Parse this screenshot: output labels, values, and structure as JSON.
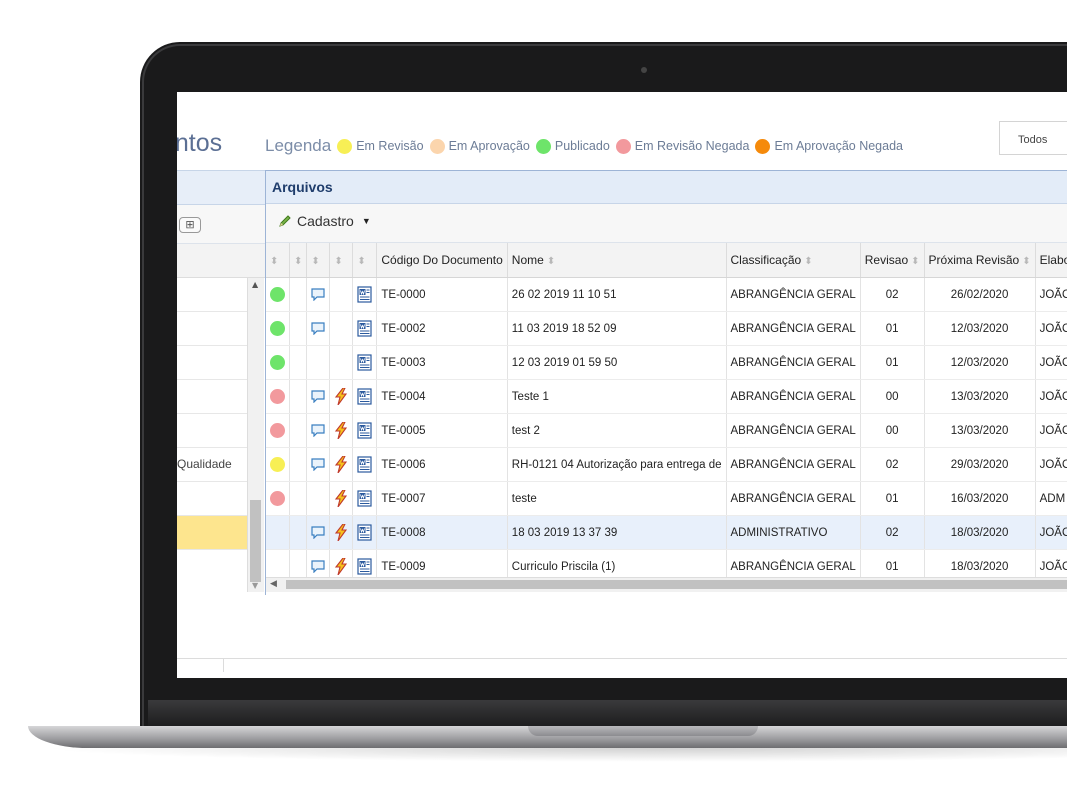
{
  "header": {
    "title_fragment": "entos",
    "legend_label": "Legenda",
    "legend": [
      {
        "label": "Em Revisão",
        "color": "#f7ef55"
      },
      {
        "label": "Em Aprovação",
        "color": "#fbd5ad"
      },
      {
        "label": "Publicado",
        "color": "#6ee46a"
      },
      {
        "label": "Em Revisão Negada",
        "color": "#f2999d"
      },
      {
        "label": "Em Aprovação Negada",
        "color": "#f58a0b"
      }
    ],
    "filter_value": "Todos"
  },
  "left_panel": {
    "expand_label": "⊞",
    "rows": [
      "",
      "",
      "",
      "",
      "",
      "Qualidade",
      "",
      ""
    ],
    "selected_row": 7
  },
  "files": {
    "title": "Arquivos",
    "cadastro_label": "Cadastro",
    "columns": [
      "",
      "",
      "",
      "",
      "",
      "Código Do Documento",
      "Nome",
      "Classificação",
      "Revisao",
      "Próxima Revisão",
      "Elaborador"
    ],
    "rows": [
      {
        "status": "green",
        "comment": true,
        "bolt": false,
        "code": "TE-0000",
        "name": "26 02 2019 11 10 51",
        "class": "ABRANGÊNCIA GERAL",
        "rev": "02",
        "next": "26/02/2020",
        "author": "JOÃO LOPES"
      },
      {
        "status": "green",
        "comment": true,
        "bolt": false,
        "code": "TE-0002",
        "name": "11 03 2019 18 52 09",
        "class": "ABRANGÊNCIA GERAL",
        "rev": "01",
        "next": "12/03/2020",
        "author": "JOÃO LOPES"
      },
      {
        "status": "green",
        "comment": false,
        "bolt": false,
        "code": "TE-0003",
        "name": "12 03 2019 01 59 50",
        "class": "ABRANGÊNCIA GERAL",
        "rev": "01",
        "next": "12/03/2020",
        "author": "JOÃO LOPES"
      },
      {
        "status": "red",
        "comment": true,
        "bolt": true,
        "code": "TE-0004",
        "name": "Teste 1",
        "class": "ABRANGÊNCIA GERAL",
        "rev": "00",
        "next": "13/03/2020",
        "author": "JOÃO LOPES"
      },
      {
        "status": "red",
        "comment": true,
        "bolt": true,
        "code": "TE-0005",
        "name": "test 2",
        "class": "ABRANGÊNCIA GERAL",
        "rev": "00",
        "next": "13/03/2020",
        "author": "JOÃO LOPES"
      },
      {
        "status": "yellow",
        "comment": true,
        "bolt": true,
        "code": "TE-0006",
        "name": "RH-0121 04 Autorização para entrega de",
        "class": "ABRANGÊNCIA GERAL",
        "rev": "02",
        "next": "29/03/2020",
        "author": "JOÃO LOPES"
      },
      {
        "status": "red",
        "comment": false,
        "bolt": true,
        "code": "TE-0007",
        "name": "teste",
        "class": "ABRANGÊNCIA GERAL",
        "rev": "01",
        "next": "16/03/2020",
        "author": "ADM"
      },
      {
        "status": "none",
        "comment": true,
        "bolt": true,
        "code": "TE-0008",
        "name": "18 03 2019 13 37 39",
        "class": "ADMINISTRATIVO",
        "rev": "02",
        "next": "18/03/2020",
        "author": "JOÃO LOPES"
      },
      {
        "status": "none",
        "comment": true,
        "bolt": true,
        "code": "TE-0009",
        "name": "Curriculo Priscila (1)",
        "class": "ABRANGÊNCIA GERAL",
        "rev": "01",
        "next": "18/03/2020",
        "author": "JOÃO LOPES"
      }
    ],
    "selected_row": 7
  },
  "colors": {
    "status_green": "#6ee46a",
    "status_red": "#f2999d",
    "status_yellow": "#f7ef55"
  },
  "icons": {
    "comment": "comment-icon",
    "bolt": "bolt-icon",
    "document": "word-document-icon",
    "pencil": "pencil-icon",
    "sort": "sort-icon"
  }
}
